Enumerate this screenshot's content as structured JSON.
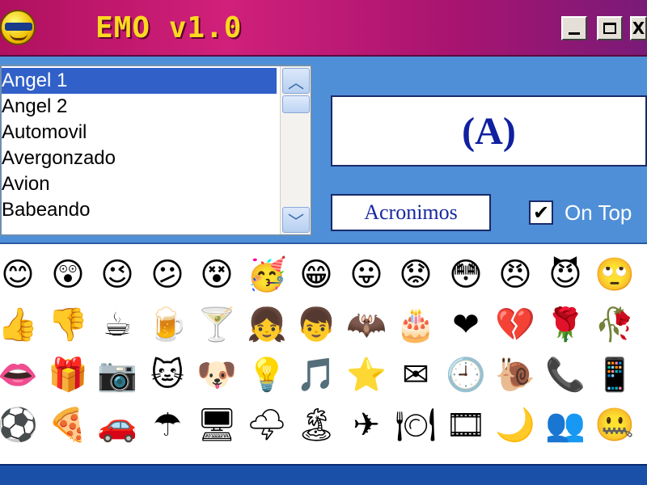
{
  "window": {
    "title": "EMO v1.0",
    "buttons": {
      "minimize": "_",
      "maximize": "□",
      "close": "X"
    }
  },
  "list": {
    "items": [
      "Angel 1",
      "Angel 2",
      "Automovil",
      "Avergonzado",
      "Avion",
      "Babeando"
    ],
    "selected_index": 0
  },
  "preview": {
    "code": "(A)"
  },
  "acronimos_button": {
    "label": "Acronimos"
  },
  "on_top": {
    "label": "On Top",
    "checked": true
  },
  "emoticons": [
    [
      {
        "name": "smile",
        "glyph": "😊"
      },
      {
        "name": "surprised",
        "glyph": "😲"
      },
      {
        "name": "wink",
        "glyph": "😉"
      },
      {
        "name": "confused",
        "glyph": "😕"
      },
      {
        "name": "crazy",
        "glyph": "😵"
      },
      {
        "name": "party",
        "glyph": "🥳"
      },
      {
        "name": "grin",
        "glyph": "😁"
      },
      {
        "name": "tongue",
        "glyph": "😛"
      },
      {
        "name": "sad",
        "glyph": "😟"
      },
      {
        "name": "embarrassed",
        "glyph": "😳"
      },
      {
        "name": "angry",
        "glyph": "😠"
      },
      {
        "name": "devil",
        "glyph": "😈"
      },
      {
        "name": "eye-roll",
        "glyph": "🙄"
      }
    ],
    [
      {
        "name": "thumbs-up",
        "glyph": "👍"
      },
      {
        "name": "thumbs-down",
        "glyph": "👎"
      },
      {
        "name": "coffee",
        "glyph": "☕"
      },
      {
        "name": "beer",
        "glyph": "🍺"
      },
      {
        "name": "cocktail",
        "glyph": "🍸"
      },
      {
        "name": "girl",
        "glyph": "👧"
      },
      {
        "name": "boy",
        "glyph": "👦"
      },
      {
        "name": "bat",
        "glyph": "🦇"
      },
      {
        "name": "cake",
        "glyph": "🎂"
      },
      {
        "name": "heart",
        "glyph": "❤"
      },
      {
        "name": "broken-heart",
        "glyph": "💔"
      },
      {
        "name": "rose",
        "glyph": "🌹"
      },
      {
        "name": "wilted-rose",
        "glyph": "🥀"
      }
    ],
    [
      {
        "name": "lips",
        "glyph": "👄"
      },
      {
        "name": "gift",
        "glyph": "🎁"
      },
      {
        "name": "camera",
        "glyph": "📷"
      },
      {
        "name": "cat",
        "glyph": "🐱"
      },
      {
        "name": "dog",
        "glyph": "🐶"
      },
      {
        "name": "light-bulb",
        "glyph": "💡"
      },
      {
        "name": "music-note",
        "glyph": "🎵"
      },
      {
        "name": "star",
        "glyph": "⭐"
      },
      {
        "name": "envelope",
        "glyph": "✉"
      },
      {
        "name": "clock",
        "glyph": "🕘"
      },
      {
        "name": "snail",
        "glyph": "🐌"
      },
      {
        "name": "phone",
        "glyph": "📞"
      },
      {
        "name": "mobile-phone",
        "glyph": "📱"
      }
    ],
    [
      {
        "name": "soccer-ball",
        "glyph": "⚽"
      },
      {
        "name": "pizza",
        "glyph": "🍕"
      },
      {
        "name": "car",
        "glyph": "🚗"
      },
      {
        "name": "umbrella",
        "glyph": "☂"
      },
      {
        "name": "computer",
        "glyph": "🖥"
      },
      {
        "name": "storm",
        "glyph": "🌩"
      },
      {
        "name": "island",
        "glyph": "🏝"
      },
      {
        "name": "airplane",
        "glyph": "✈"
      },
      {
        "name": "plate",
        "glyph": "🍽"
      },
      {
        "name": "film",
        "glyph": "🎞"
      },
      {
        "name": "moon",
        "glyph": "🌙"
      },
      {
        "name": "messenger",
        "glyph": "👥"
      },
      {
        "name": "zipped-mouth",
        "glyph": "🤐"
      }
    ]
  ],
  "colors": {
    "title_text": "#ffd820",
    "panel_blue": "#4f8fd8",
    "selection": "#3160c8",
    "preview_text": "#1020a0"
  }
}
